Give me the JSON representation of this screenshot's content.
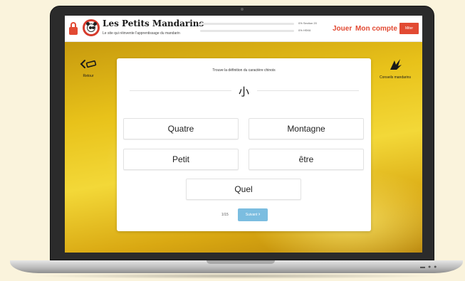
{
  "header": {
    "site_title": "Les Petits Mandarins",
    "tagline": "Le site qui réinvente l'apprentissage du mandarin",
    "progress": [
      {
        "label": "0% Section 20",
        "value": 0
      },
      {
        "label": "0% HSK6",
        "value": 0
      }
    ],
    "nav_play": "Jouer",
    "nav_account": "Mon compte",
    "cta_label": "Miter"
  },
  "stage": {
    "back_icon": "back-arrow-icon",
    "back_label": "Retour",
    "mascot_icon": "mandarin-mascot-icon",
    "mascot_label": "Conseils mandarins"
  },
  "quiz": {
    "prompt": "Trouve la définition du caractère chinois",
    "character": "小",
    "answers": [
      "Quatre",
      "Montagne",
      "Petit",
      "être",
      "Quel"
    ],
    "pager": "1/15",
    "next_label": "Suivant",
    "next_icon": "chevron-right-icon"
  },
  "colors": {
    "accent": "#e24a33",
    "next_button": "#7bbde0",
    "background_gold": "#e8c21a"
  }
}
